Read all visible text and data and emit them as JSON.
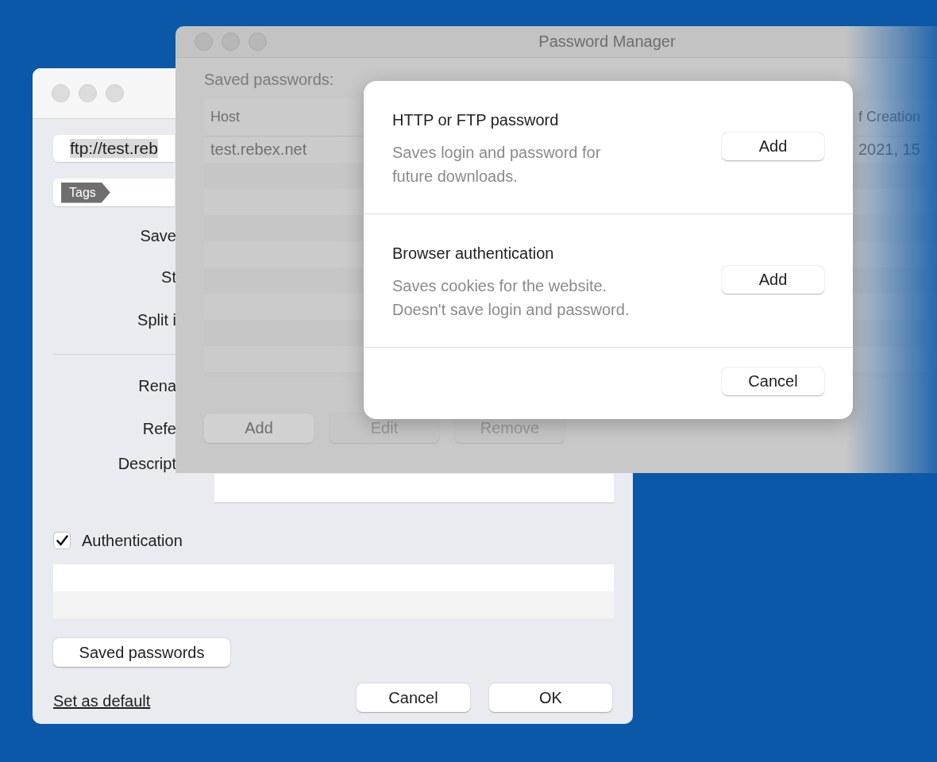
{
  "back_window": {
    "url": "ftp://test.reb",
    "tag": "Tags",
    "labels_top": [
      "Save",
      "St",
      "Split i"
    ],
    "labels_mid": [
      "Rena",
      "Refe"
    ],
    "description_label": "Descript",
    "authentication": {
      "label": "Authentication",
      "checked": true
    },
    "saved_passwords_button": "Saved passwords",
    "default_link": "Set as default",
    "buttons": [
      "Cancel",
      "OK"
    ]
  },
  "password_manager": {
    "title": "Password Manager",
    "heading": "Saved passwords:",
    "columns": [
      "Host",
      "f Creation"
    ],
    "rows": [
      [
        "test.rebex.net",
        "2021, 15"
      ]
    ],
    "buttons": [
      {
        "label": "Add",
        "disabled": false
      },
      {
        "label": "Edit",
        "disabled": true
      },
      {
        "label": "Remove",
        "disabled": true
      }
    ]
  },
  "sheet": {
    "options": [
      {
        "title": "HTTP or FTP password",
        "description": [
          "Saves login and password for",
          "future downloads."
        ],
        "button": "Add"
      },
      {
        "title": "Browser authentication",
        "description": [
          "Saves cookies for the website.",
          "Doesn't save login and password."
        ],
        "button": "Add"
      }
    ],
    "cancel": "Cancel"
  }
}
